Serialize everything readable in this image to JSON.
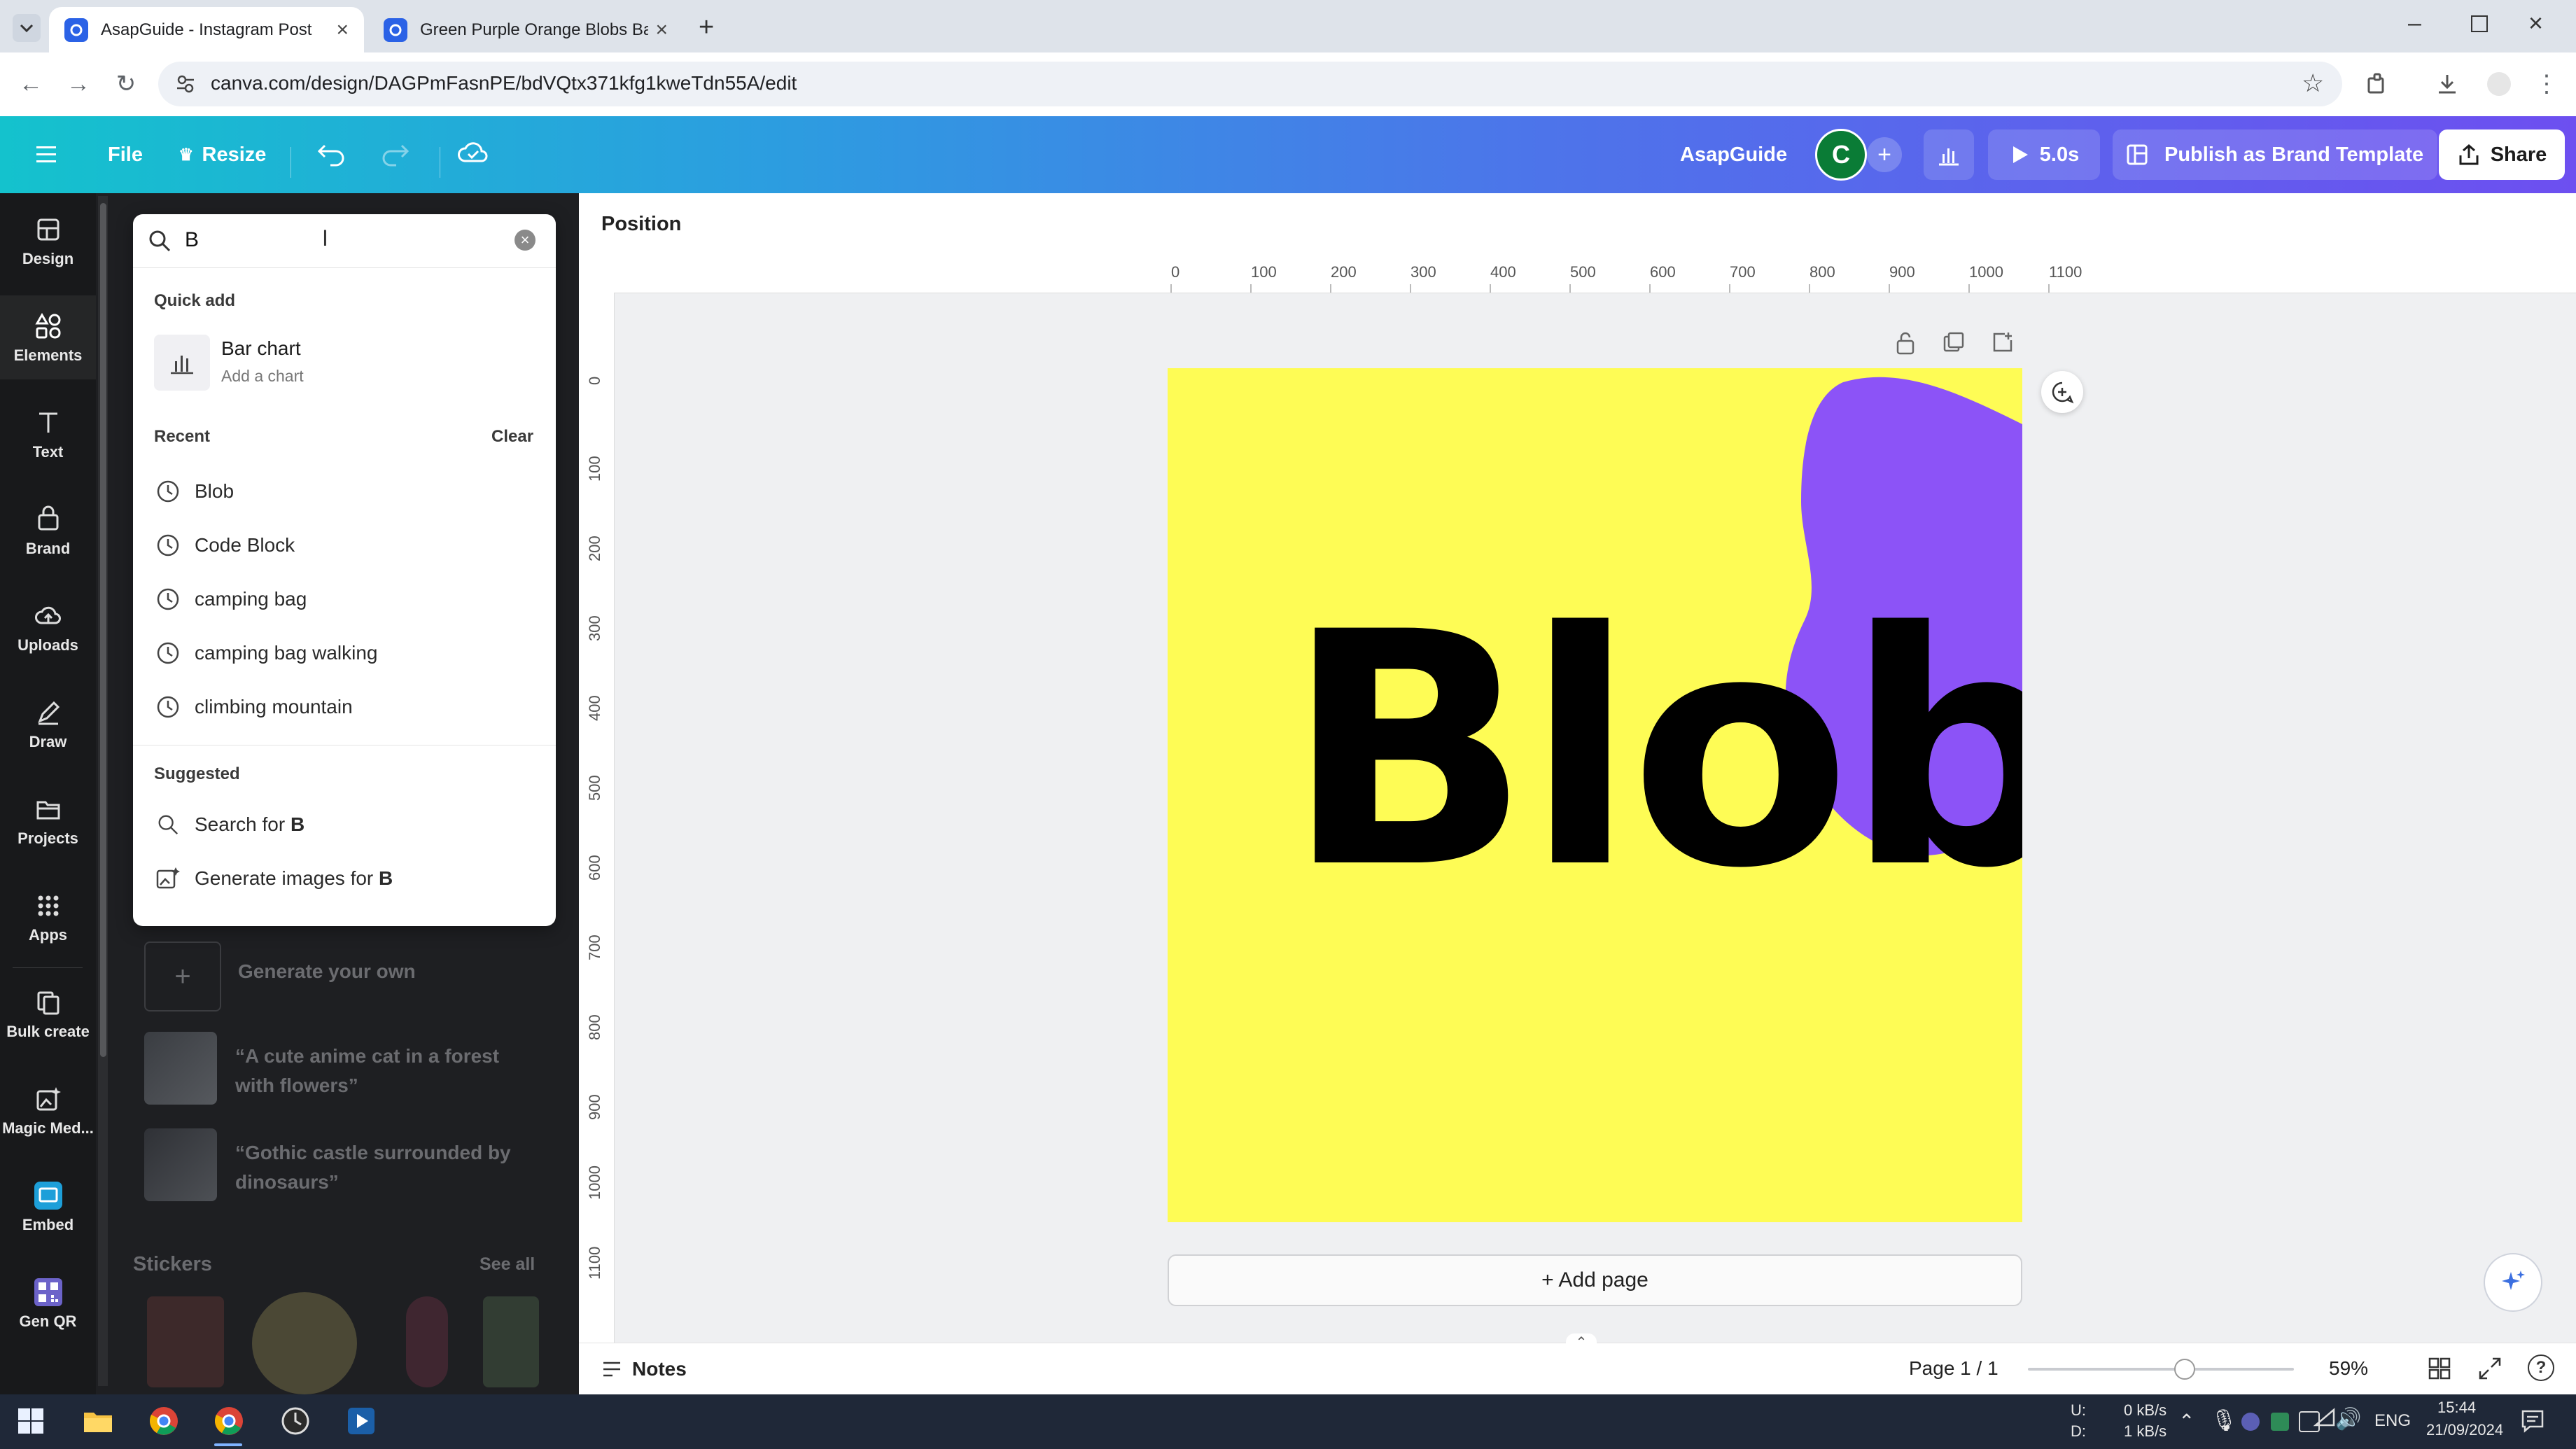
{
  "browser": {
    "tabs": [
      {
        "title": "AsapGuide - Instagram Post",
        "active": true
      },
      {
        "title": "Green Purple Orange Blobs Bas",
        "active": false
      }
    ],
    "url": "canva.com/design/DAGPmFasnPE/bdVQtx371kfg1kweTdn55A/edit"
  },
  "topbar": {
    "file_label": "File",
    "resize_label": "Resize",
    "team_name": "AsapGuide",
    "avatar_initial": "C",
    "timer_label": "5.0s",
    "publish_label": "Publish as Brand Template",
    "share_label": "Share"
  },
  "rail": {
    "items": [
      {
        "label": "Design",
        "icon": "design-icon"
      },
      {
        "label": "Elements",
        "icon": "elements-icon"
      },
      {
        "label": "Text",
        "icon": "text-icon"
      },
      {
        "label": "Brand",
        "icon": "brand-icon"
      },
      {
        "label": "Uploads",
        "icon": "uploads-icon"
      },
      {
        "label": "Draw",
        "icon": "draw-icon"
      },
      {
        "label": "Projects",
        "icon": "projects-icon"
      },
      {
        "label": "Apps",
        "icon": "apps-icon"
      },
      {
        "label": "Bulk create",
        "icon": "bulk-create-icon"
      },
      {
        "label": "Magic Med...",
        "icon": "magic-media-icon"
      },
      {
        "label": "Embed",
        "icon": "embed-icon"
      },
      {
        "label": "Gen QR",
        "icon": "qr-icon"
      }
    ]
  },
  "search": {
    "value": "B",
    "quick_add_heading": "Quick add",
    "quick_add_title": "Bar chart",
    "quick_add_subtitle": "Add a chart",
    "recent_heading": "Recent",
    "clear_label": "Clear",
    "recent": [
      "Blob",
      "Code Block",
      "camping bag",
      "camping bag walking",
      "climbing mountain"
    ],
    "suggested_heading": "Suggested",
    "suggest_search_prefix": "Search for ",
    "suggest_generate_prefix": "Generate images for ",
    "suggest_term": "B"
  },
  "panel": {
    "generate_label": "Generate your own",
    "prompts": [
      "“A cute anime cat in a forest with flowers”",
      "“Gothic castle surrounded by dinosaurs”"
    ],
    "stickers_heading": "Stickers",
    "see_all_label": "See all"
  },
  "canvas": {
    "position_label": "Position",
    "h_ruler": [
      "0",
      "100",
      "200",
      "300",
      "400",
      "500",
      "600",
      "700",
      "800",
      "900",
      "1000",
      "1100"
    ],
    "v_ruler": [
      "0",
      "100",
      "200",
      "300",
      "400",
      "500",
      "600",
      "700",
      "800",
      "900",
      "1000",
      "1100"
    ],
    "design_text": "Blob",
    "background_color": "#fefc55",
    "blob_color": "#8c53f7",
    "add_page_label": "+ Add page"
  },
  "status": {
    "notes_label": "Notes",
    "page_label": "Page 1 / 1",
    "zoom_label": "59%",
    "zoom_level": 0.59
  },
  "taskbar": {
    "net_up": "0 kB/s",
    "net_down": "1 kB/s",
    "net_up_label": "U:",
    "net_down_label": "D:",
    "lang": "ENG",
    "time": "15:44",
    "date": "21/09/2024"
  }
}
